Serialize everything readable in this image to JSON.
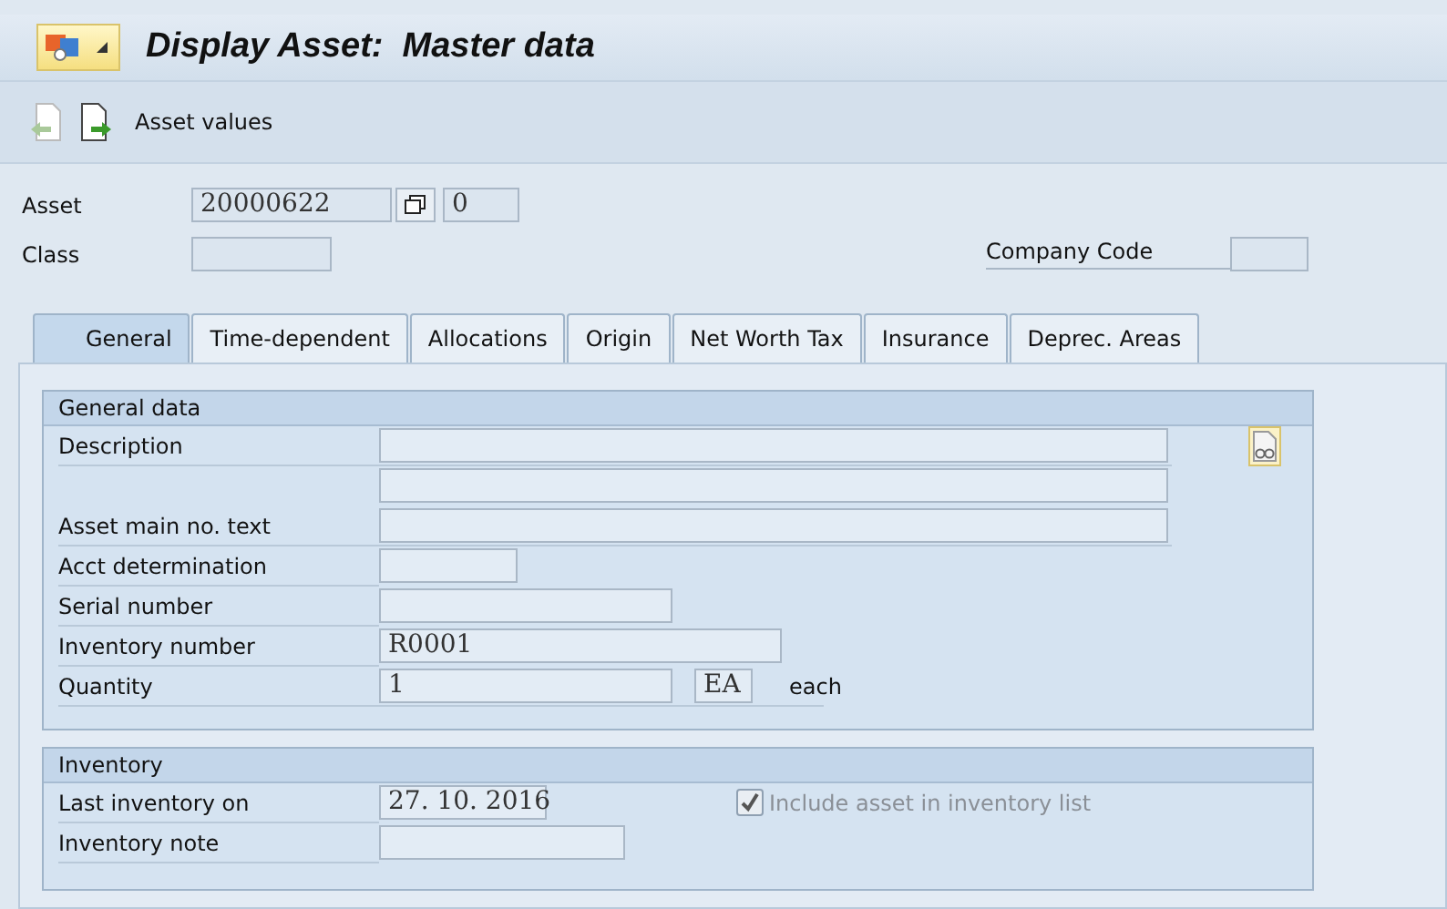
{
  "window": {
    "title": "Display Asset:  Master data"
  },
  "toolbar": {
    "buttons": [
      {
        "kind": "back"
      },
      {
        "kind": "forward",
        "label": "Asset values"
      }
    ]
  },
  "header": {
    "asset_label": "Asset",
    "asset_value": "20000622",
    "asset_subnumber": "0",
    "class_label": "Class",
    "company_code_label": "Company Code"
  },
  "tabs": [
    {
      "label": "General",
      "selected": true
    },
    {
      "label": "Time-dependent",
      "selected": false
    },
    {
      "label": "Allocations",
      "selected": false
    },
    {
      "label": "Origin",
      "selected": false
    },
    {
      "label": "Net Worth Tax",
      "selected": false
    },
    {
      "label": "Insurance",
      "selected": false
    },
    {
      "label": "Deprec. Areas",
      "selected": false
    }
  ],
  "general_group": {
    "title": "General data",
    "rows": [
      {
        "kind": "long",
        "label": "Description"
      },
      {
        "kind": "long"
      },
      {
        "kind": "long",
        "label": "Asset main no. text"
      },
      {
        "kind": "code",
        "label": "Acct determination"
      },
      {
        "kind": "medium",
        "label": "Serial number"
      },
      {
        "kind": "wide",
        "label": "Inventory number",
        "value": "R0001"
      },
      {
        "kind": "quantity",
        "label": "Quantity",
        "value": "1",
        "unit": "EA",
        "unit_text": "each"
      }
    ]
  },
  "inventory_group": {
    "title": "Inventory",
    "rows": [
      {
        "label": "Last inventory on",
        "value": "27. 10. 2016"
      },
      {
        "label": "Inventory note"
      }
    ],
    "checkbox": {
      "label": "Include asset in inventory list",
      "checked": true,
      "disabled": true
    }
  }
}
